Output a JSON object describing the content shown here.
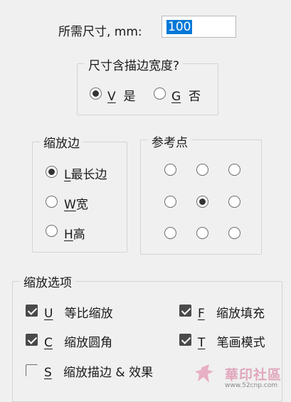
{
  "size": {
    "label": "所需尺寸, mm:",
    "value": "100"
  },
  "include_stroke": {
    "title": "尺寸含描边宽度?",
    "options": [
      {
        "key": "V",
        "label": "是",
        "selected": true
      },
      {
        "key": "G",
        "label": "否",
        "selected": false
      }
    ]
  },
  "scale_edge": {
    "title": "缩放边",
    "options": [
      {
        "key": "L",
        "label": "最长边",
        "selected": true
      },
      {
        "key": "W",
        "label": "宽",
        "selected": false
      },
      {
        "key": "H",
        "label": "高",
        "selected": false
      }
    ]
  },
  "reference_point": {
    "title": "参考点",
    "selected": "center"
  },
  "scale_options": {
    "title": "缩放选项",
    "items": [
      {
        "key": "U",
        "label": "等比缩放",
        "checked": true
      },
      {
        "key": "F",
        "label": "缩放填充",
        "checked": true
      },
      {
        "key": "C",
        "label": "缩放圆角",
        "checked": true
      },
      {
        "key": "T",
        "label": "笔画模式",
        "checked": true
      },
      {
        "key": "S",
        "label": "缩放描边 & 效果",
        "checked": false
      }
    ]
  },
  "watermark": {
    "text": "華印社區",
    "url": "www.52cnp.com"
  }
}
